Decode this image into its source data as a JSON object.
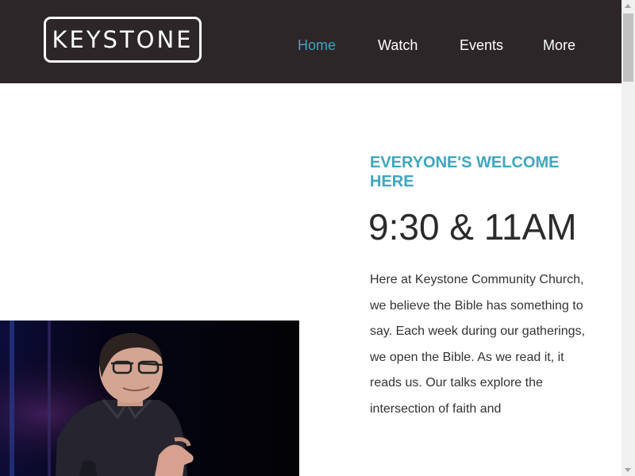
{
  "header": {
    "logo_text": "KEYSTONE",
    "nav": [
      {
        "label": "Home",
        "active": true
      },
      {
        "label": "Watch",
        "active": false
      },
      {
        "label": "Events",
        "active": false
      },
      {
        "label": "More",
        "active": false
      }
    ]
  },
  "hero": {
    "image": "speaker-photo"
  },
  "content": {
    "tagline": "EVERYONE'S WELCOME HERE",
    "service_time": "9:30 & 11AM",
    "body": "Here at Keystone Community Church, we believe the Bible has something to say. Each week during our gatherings, we open the Bible. As we read it, it reads us. Our talks explore the intersection of faith and"
  },
  "colors": {
    "header_bg": "#2d2629",
    "accent": "#3ea6bf",
    "text": "#333333"
  }
}
